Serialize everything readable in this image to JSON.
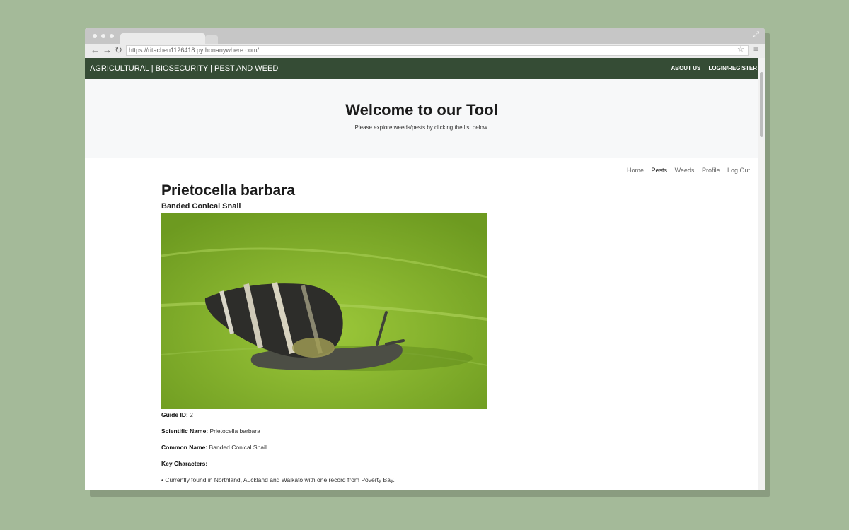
{
  "browser": {
    "url": "https://ritachen1126418.pythonanywhere.com/",
    "icons": [
      "back-icon",
      "forward-icon",
      "reload-icon",
      "star-icon",
      "menu-icon",
      "expand-icon"
    ]
  },
  "topnav": {
    "brand": "AGRICULTURAL | BIOSECURITY | PEST AND WEED",
    "links": [
      "ABOUT US",
      "LOGIN/REGISTER"
    ]
  },
  "hero": {
    "title": "Welcome to our Tool",
    "subtitle": "Please explore weeds/pests by clicking the list below."
  },
  "subnav": {
    "items": [
      "Home",
      "Pests",
      "Weeds",
      "Profile",
      "Log Out"
    ],
    "active": "Pests"
  },
  "pest": {
    "scientific_title": "Prietocella barbara",
    "common_title": "Banded Conical Snail",
    "details": [
      {
        "label": "Guide ID:",
        "value": " 2"
      },
      {
        "label": "Scientific Name:",
        "value": " Prietocella barbara"
      },
      {
        "label": "Common Name:",
        "value": " Banded Conical Snail"
      },
      {
        "label": "Key Characters:",
        "value": ""
      }
    ],
    "bullet": "• Currently found in Northland, Auckland and Waikato with one record from Poverty Bay."
  },
  "colors": {
    "page_bg": "#a4ba99",
    "topnav_bg": "#354c35",
    "hero_bg": "#f7f8f9"
  }
}
